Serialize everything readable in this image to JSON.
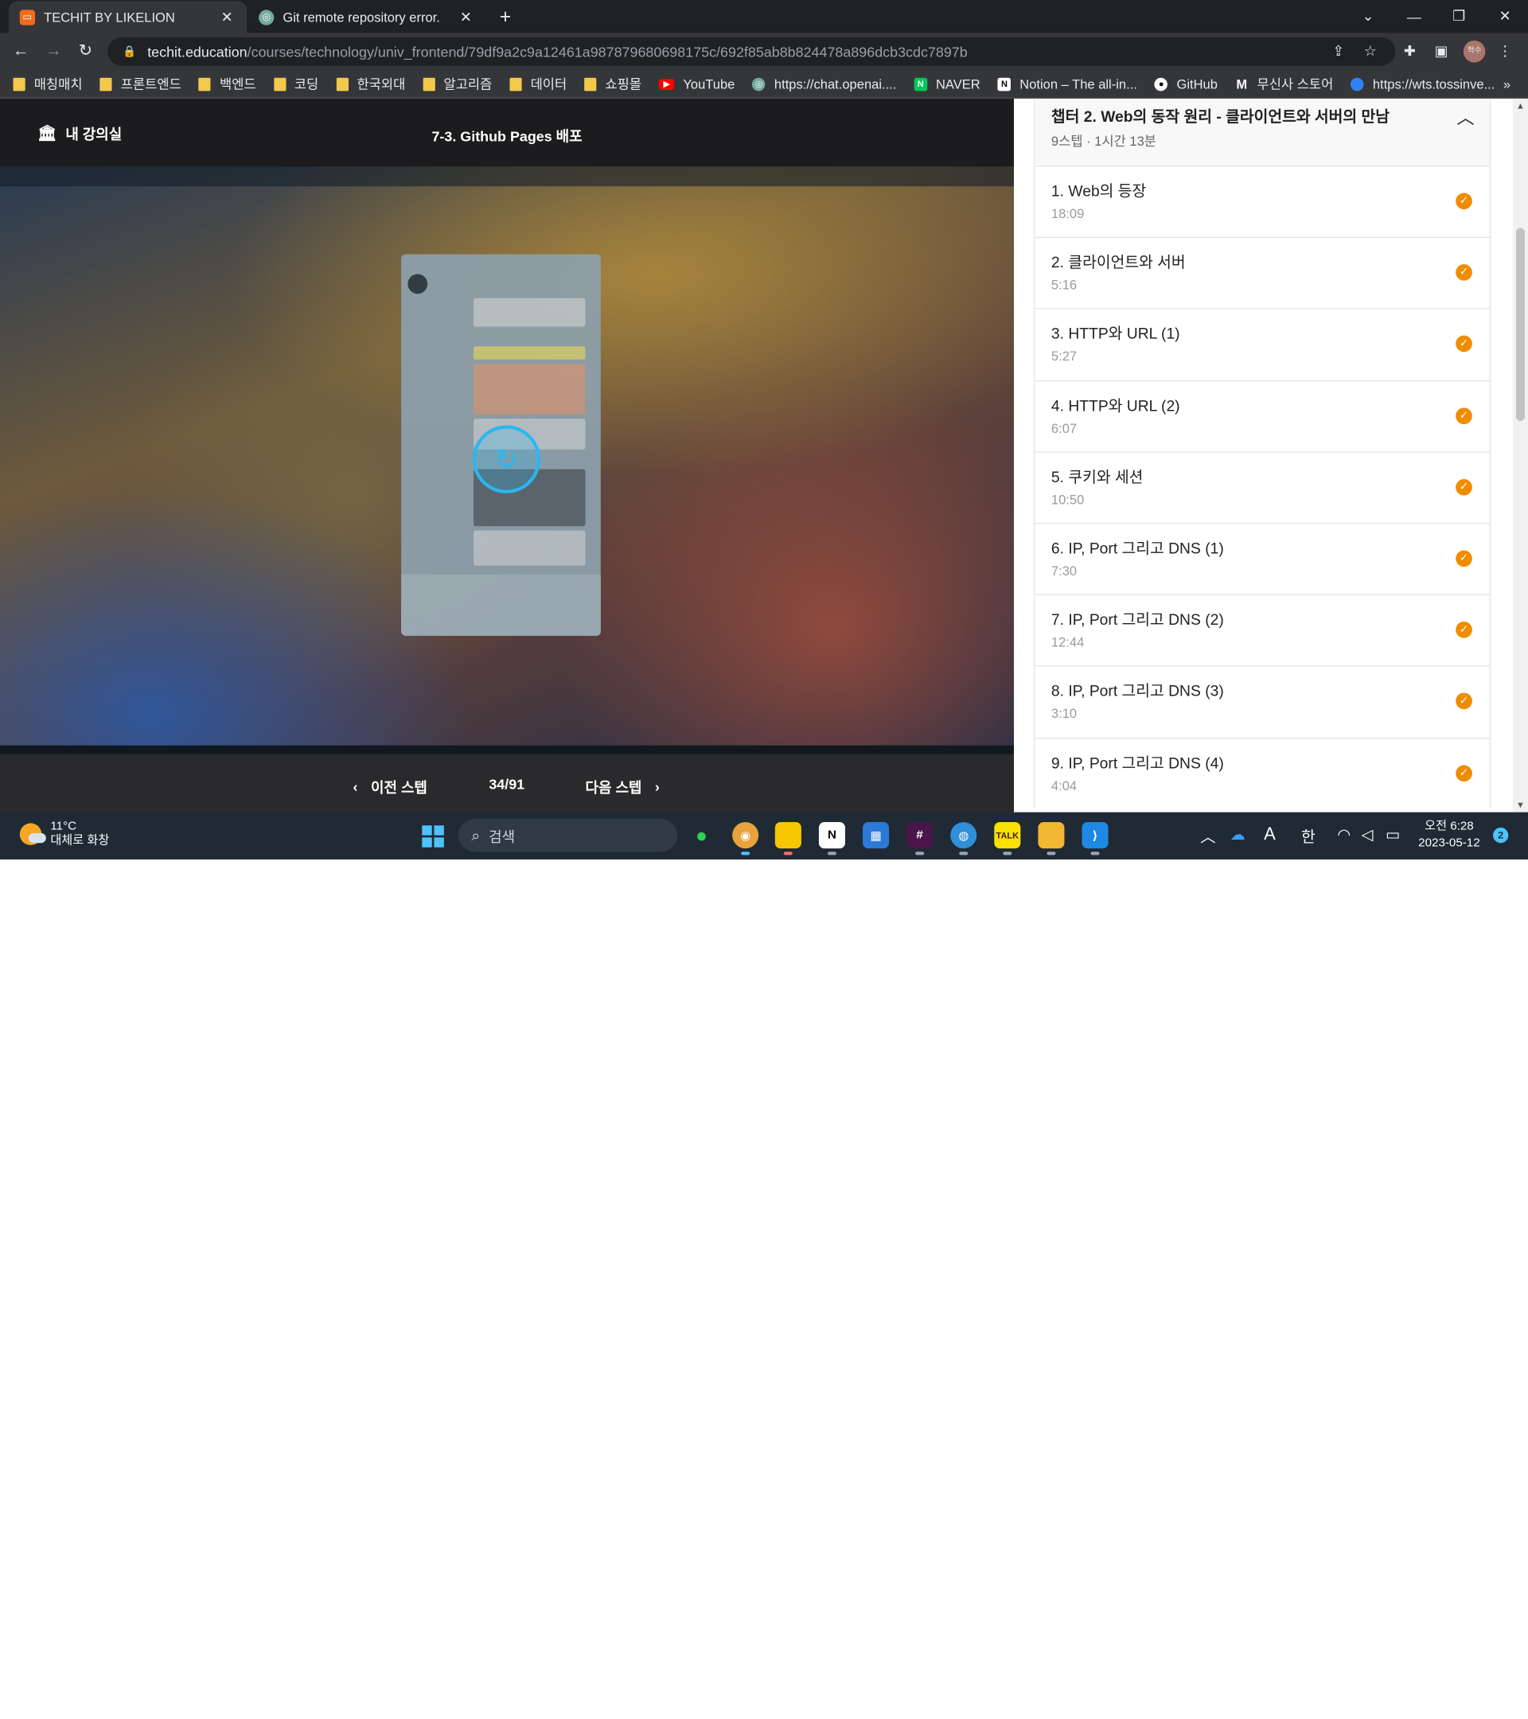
{
  "browser": {
    "tabs": [
      {
        "title": "TECHIT BY LIKELION",
        "favicon": "techit-icon",
        "active": true
      },
      {
        "title": "Git remote repository error.",
        "favicon": "chatgpt-icon",
        "active": false
      }
    ],
    "address": {
      "host": "techit.education",
      "path": "/courses/technology/univ_frontend/79df9a2c9a12461a987879680698175c/692f85ab8b824478a896dcb3cdc7897b"
    },
    "profile_label": "혁수",
    "bookmarks": [
      {
        "label": "매칭매치",
        "icon": "folder-icon"
      },
      {
        "label": "프론트엔드",
        "icon": "folder-icon"
      },
      {
        "label": "백엔드",
        "icon": "folder-icon"
      },
      {
        "label": "코딩",
        "icon": "folder-icon"
      },
      {
        "label": "한국외대",
        "icon": "folder-icon"
      },
      {
        "label": "알고리즘",
        "icon": "folder-icon"
      },
      {
        "label": "데이터",
        "icon": "folder-icon"
      },
      {
        "label": "쇼핑몰",
        "icon": "folder-icon"
      },
      {
        "label": "YouTube",
        "icon": "youtube-icon"
      },
      {
        "label": "https://chat.openai....",
        "icon": "chatgpt-icon"
      },
      {
        "label": "NAVER",
        "icon": "naver-icon"
      },
      {
        "label": "Notion – The all-in...",
        "icon": "notion-icon"
      },
      {
        "label": "GitHub",
        "icon": "github-icon"
      },
      {
        "label": "무신사 스토어",
        "icon": "musinsa-icon"
      },
      {
        "label": "https://wts.tossinve...",
        "icon": "toss-icon"
      }
    ],
    "bookmarks_more": "»"
  },
  "player": {
    "my_classroom": "내 강의실",
    "lesson_title": "7-3. Github Pages 배포",
    "prev_step": "이전 스텝",
    "step_counter": "34/91",
    "next_step": "다음 스텝"
  },
  "sidebar": {
    "chapter_title": "챕터 2. Web의 동작 원리 - 클라이언트와 서버의 만남",
    "chapter_meta": "9스텝 · 1시간 13분",
    "lessons": [
      {
        "name": "1. Web의 등장",
        "duration": "18:09",
        "completed": true
      },
      {
        "name": "2. 클라이언트와 서버",
        "duration": "5:16",
        "completed": true
      },
      {
        "name": "3. HTTP와 URL (1)",
        "duration": "5:27",
        "completed": true
      },
      {
        "name": "4. HTTP와 URL (2)",
        "duration": "6:07",
        "completed": true
      },
      {
        "name": "5. 쿠키와 세션",
        "duration": "10:50",
        "completed": true
      },
      {
        "name": "6. IP, Port 그리고 DNS (1)",
        "duration": "7:30",
        "completed": true
      },
      {
        "name": "7. IP, Port 그리고 DNS (2)",
        "duration": "12:44",
        "completed": true
      },
      {
        "name": "8. IP, Port 그리고 DNS (3)",
        "duration": "3:10",
        "completed": true
      },
      {
        "name": "9. IP, Port 그리고 DNS (4)",
        "duration": "4:04",
        "completed": true
      }
    ]
  },
  "taskbar": {
    "weather_temp": "11°C",
    "weather_desc": "대체로 화창",
    "search_placeholder": "검색",
    "ime_a": "A",
    "ime_han": "한",
    "clock_time": "오전 6:28",
    "clock_date": "2023-05-12",
    "notification_count": "2"
  },
  "colors": {
    "accent_check": "#f08c00",
    "replay_blue": "#2ab7f0",
    "browser_dark": "#202124"
  }
}
